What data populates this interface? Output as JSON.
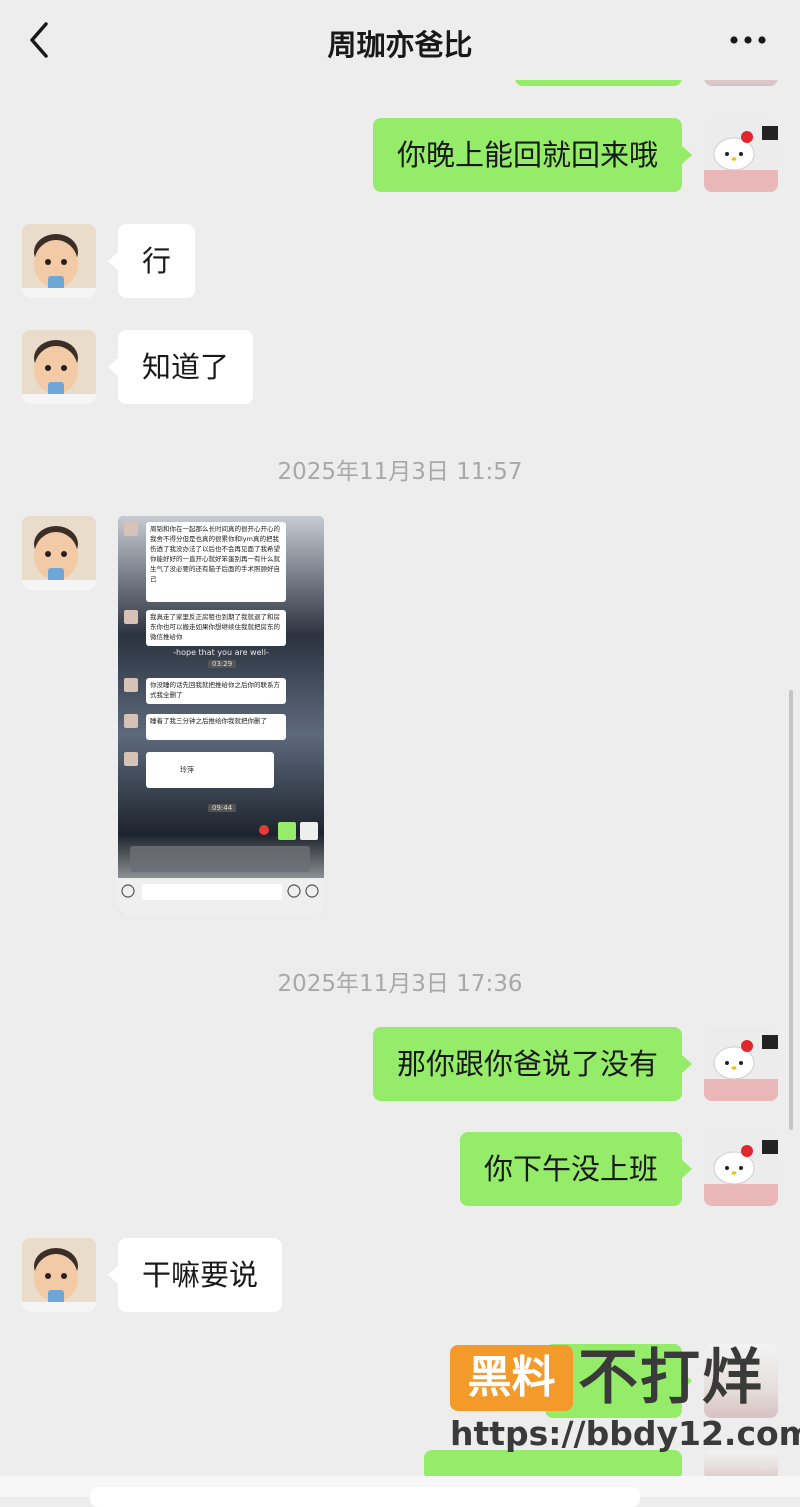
{
  "header": {
    "title": "周珈亦爸比",
    "back_icon": "chevron-left-icon",
    "more_icon": "more-dots-icon"
  },
  "messages": [
    {
      "from": "me",
      "text": "你晚上能回就回来哦"
    },
    {
      "from": "other",
      "text": "行"
    },
    {
      "from": "other",
      "text": "知道了"
    },
    {
      "from": "me",
      "text": "那你跟你爸说了没有"
    },
    {
      "from": "me",
      "text": "你下午没上班"
    },
    {
      "from": "other",
      "text": "干嘛要说"
    }
  ],
  "timestamps": [
    "2025年11月3日 11:57",
    "2025年11月3日 17:36"
  ],
  "image_message": {
    "lines": [
      "周韬和你在一起那么长时间真的很开心开心的我舍不得分但是也真的很累你和lym真的把我伤透了我没办法了以后也不会再见面了我希望你能好好的一直开心就好笨蛋别再一有什么就生气了没必要的还有脑子后面的手术照顾好自己",
      "我真走了家里反正房租也到期了我就退了和房东你也可以搬走如果你想继续住我就把房东的微信推给你",
      "-hope that you are well-",
      "03:29",
      "你没睡的话先回我就把推给你之后你的联系方式我全删了",
      "睡着了我三分钟之后推给你我就把你删了",
      "玲萍",
      "09:44"
    ]
  },
  "watermark": {
    "box_text": "黑料",
    "text": "不打烊",
    "url": "https://bbdy12.com"
  },
  "colors": {
    "background": "#ededed",
    "bubble_me": "#95ec69",
    "bubble_other": "#ffffff",
    "timestamp": "#a8a8a8",
    "watermark_accent": "#f39a2b"
  }
}
